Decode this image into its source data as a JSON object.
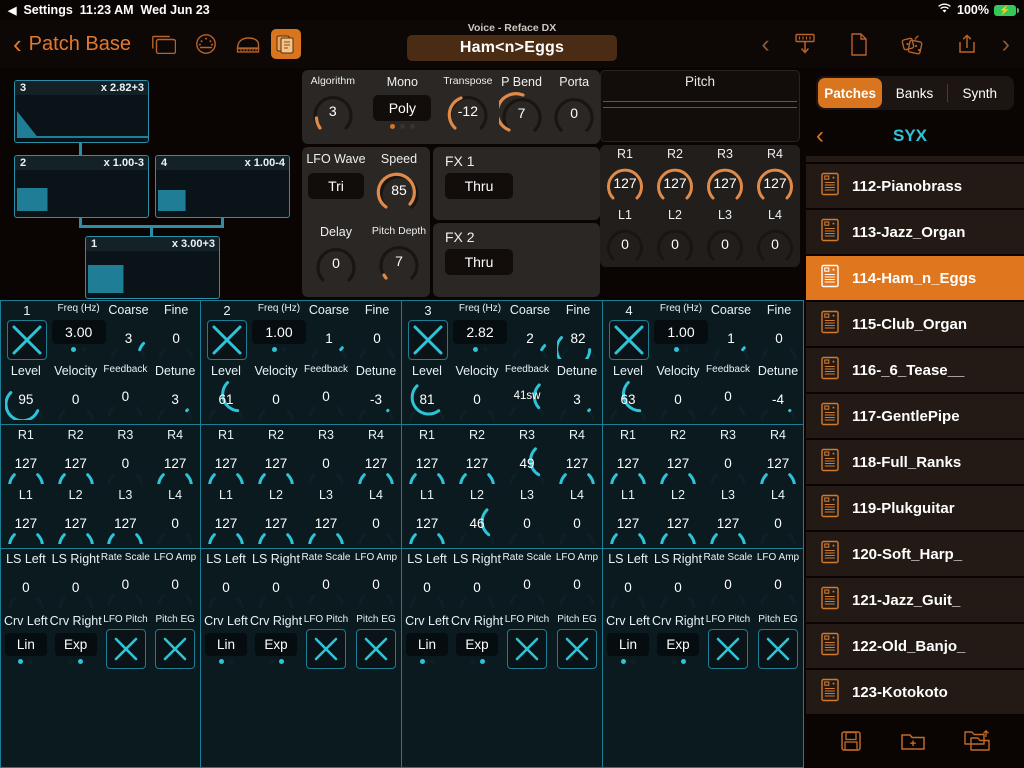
{
  "statusbar": {
    "back_label": "Settings",
    "time": "11:23 AM",
    "date": "Wed Jun 23",
    "battery": "100%"
  },
  "header": {
    "back_label": "Patch Base",
    "voice_label": "Voice - Reface DX",
    "voice_name": "Ham<n>Eggs",
    "icons": [
      "window-icon",
      "midi-din-icon",
      "piano-icon",
      "patch-files-icon"
    ],
    "right_icons": [
      "chevron-left-icon",
      "download-from-synth-icon",
      "new-document-icon",
      "randomize-dice-icon",
      "share-upload-icon",
      "chevron-right-icon"
    ]
  },
  "algorithm_diagram": {
    "operators": [
      {
        "num": "3",
        "ratio": "x 2.82+3"
      },
      {
        "num": "2",
        "ratio": "x 1.00-3"
      },
      {
        "num": "4",
        "ratio": "x 1.00-4"
      },
      {
        "num": "1",
        "ratio": "x 3.00+3"
      }
    ]
  },
  "controls": {
    "algorithm": {
      "label": "Algorithm",
      "value": "3"
    },
    "mono": {
      "label": "Mono",
      "value": "Poly"
    },
    "transpose": {
      "label": "Transpose",
      "value": "-12"
    },
    "pbend": {
      "label": "P Bend",
      "value": "7"
    },
    "porta": {
      "label": "Porta",
      "value": "0"
    },
    "lfo_wave": {
      "label": "LFO Wave",
      "value": "Tri"
    },
    "speed": {
      "label": "Speed",
      "value": "85"
    },
    "delay": {
      "label": "Delay",
      "value": "0"
    },
    "pitch_depth": {
      "label": "Pitch Depth",
      "value": "7"
    },
    "fx1": {
      "label": "FX 1",
      "value": "Thru"
    },
    "fx2": {
      "label": "FX 2",
      "value": "Thru"
    }
  },
  "pitch": {
    "title": "Pitch",
    "rates": {
      "labels": [
        "R1",
        "R2",
        "R3",
        "R4"
      ],
      "values": [
        "127",
        "127",
        "127",
        "127"
      ]
    },
    "levels": {
      "labels": [
        "L1",
        "L2",
        "L3",
        "L4"
      ],
      "values": [
        "0",
        "0",
        "0",
        "0"
      ]
    }
  },
  "op_labels": {
    "freq": "Freq (Hz)",
    "coarse": "Coarse",
    "fine": "Fine",
    "level": "Level",
    "velocity": "Velocity",
    "feedback": "Feedback",
    "detune": "Detune",
    "r": [
      "R1",
      "R2",
      "R3",
      "R4"
    ],
    "l": [
      "L1",
      "L2",
      "L3",
      "L4"
    ],
    "ls_left": "LS Left",
    "ls_right": "LS Right",
    "rate_scale": "Rate Scale",
    "lfo_amp": "LFO Amp",
    "crv_left": "Crv Left",
    "crv_right": "Crv Right",
    "lfo_pitch": "LFO Pitch",
    "pitch_eg": "Pitch EG"
  },
  "operators": [
    {
      "num": "1",
      "enabled_icon": "x-toggle-icon",
      "freq": "3.00",
      "coarse": "3",
      "fine": "0",
      "level": "95",
      "velocity": "0",
      "feedback": "0",
      "detune": "3",
      "r": [
        "127",
        "127",
        "0",
        "127"
      ],
      "l": [
        "127",
        "127",
        "127",
        "0"
      ],
      "ls_left": "0",
      "ls_right": "0",
      "rate_scale": "0",
      "lfo_amp": "0",
      "crv_left": "Lin",
      "crv_right": "Exp",
      "lfo_pitch": "x-toggle-icon",
      "pitch_eg": "x-toggle-icon"
    },
    {
      "num": "2",
      "enabled_icon": "x-toggle-icon",
      "freq": "1.00",
      "coarse": "1",
      "fine": "0",
      "level": "61",
      "velocity": "0",
      "feedback": "0",
      "detune": "-3",
      "r": [
        "127",
        "127",
        "0",
        "127"
      ],
      "l": [
        "127",
        "127",
        "127",
        "0"
      ],
      "ls_left": "0",
      "ls_right": "0",
      "rate_scale": "0",
      "lfo_amp": "0",
      "crv_left": "Lin",
      "crv_right": "Exp",
      "lfo_pitch": "x-toggle-icon",
      "pitch_eg": "x-toggle-icon"
    },
    {
      "num": "3",
      "enabled_icon": "x-toggle-icon",
      "freq": "2.82",
      "coarse": "2",
      "fine": "82",
      "level": "81",
      "velocity": "0",
      "feedback": "41sw",
      "detune": "3",
      "r": [
        "127",
        "127",
        "49",
        "127"
      ],
      "l": [
        "127",
        "46",
        "0",
        "0"
      ],
      "ls_left": "0",
      "ls_right": "0",
      "rate_scale": "0",
      "lfo_amp": "0",
      "crv_left": "Lin",
      "crv_right": "Exp",
      "lfo_pitch": "x-toggle-icon",
      "pitch_eg": "x-toggle-icon"
    },
    {
      "num": "4",
      "enabled_icon": "x-toggle-icon",
      "freq": "1.00",
      "coarse": "1",
      "fine": "0",
      "level": "63",
      "velocity": "0",
      "feedback": "0",
      "detune": "-4",
      "r": [
        "127",
        "127",
        "0",
        "127"
      ],
      "l": [
        "127",
        "127",
        "127",
        "0"
      ],
      "ls_left": "0",
      "ls_right": "0",
      "rate_scale": "0",
      "lfo_amp": "0",
      "crv_left": "Lin",
      "crv_right": "Exp",
      "lfo_pitch": "x-toggle-icon",
      "pitch_eg": "x-toggle-icon"
    }
  ],
  "sidebar": {
    "tabs": [
      {
        "label": "Patches",
        "active": true
      },
      {
        "label": "Banks",
        "active": false
      },
      {
        "label": "Synth",
        "active": false
      }
    ],
    "bank_title": "SYX",
    "patches": [
      {
        "name": "112-Pianobrass",
        "selected": false
      },
      {
        "name": "113-Jazz_Organ",
        "selected": false
      },
      {
        "name": "114-Ham_n_Eggs",
        "selected": true
      },
      {
        "name": "115-Club_Organ",
        "selected": false
      },
      {
        "name": "116-_6_Tease__",
        "selected": false
      },
      {
        "name": "117-GentlePipe",
        "selected": false
      },
      {
        "name": "118-Full_Ranks",
        "selected": false
      },
      {
        "name": "119-Plukguitar",
        "selected": false
      },
      {
        "name": "120-Soft_Harp_",
        "selected": false
      },
      {
        "name": "121-Jazz_Guit_",
        "selected": false
      },
      {
        "name": "122-Old_Banjo_",
        "selected": false
      },
      {
        "name": "123-Kotokoto",
        "selected": false
      }
    ],
    "footer_icons": [
      "save-icon",
      "new-folder-icon",
      "copy-folder-icon"
    ]
  },
  "colors": {
    "accent_orange": "#d9741f",
    "accent_cyan": "#2ec4d8",
    "bg": "#0a0503",
    "panel_teal": "#0a1a1f"
  }
}
